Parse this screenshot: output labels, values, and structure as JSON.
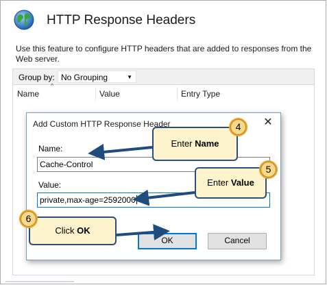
{
  "page": {
    "title": "HTTP Response Headers",
    "description": "Use this feature to configure HTTP headers that are added to responses from the Web server."
  },
  "toolbar": {
    "group_by_label": "Group by:",
    "group_by_value": "No Grouping"
  },
  "table": {
    "columns": [
      "Name",
      "Value",
      "Entry Type"
    ]
  },
  "dialog": {
    "title": "Add Custom HTTP Response Header",
    "close": "✕",
    "name_label": "Name:",
    "name_value": "Cache-Control",
    "value_label": "Value:",
    "value_value": "private,max-age=2592000",
    "ok": "OK",
    "cancel": "Cancel"
  },
  "callouts": [
    {
      "prefix": "Enter ",
      "bold": "Name",
      "step": "4"
    },
    {
      "prefix": "Enter ",
      "bold": "Value",
      "step": "5"
    },
    {
      "prefix": "Click ",
      "bold": "OK",
      "step": "6"
    }
  ],
  "colors": {
    "callout_fill": "#fdf3cc",
    "callout_border": "#2a4d7a",
    "badge_fill": "#f7d98c",
    "focus_blue": "#0078d7"
  }
}
